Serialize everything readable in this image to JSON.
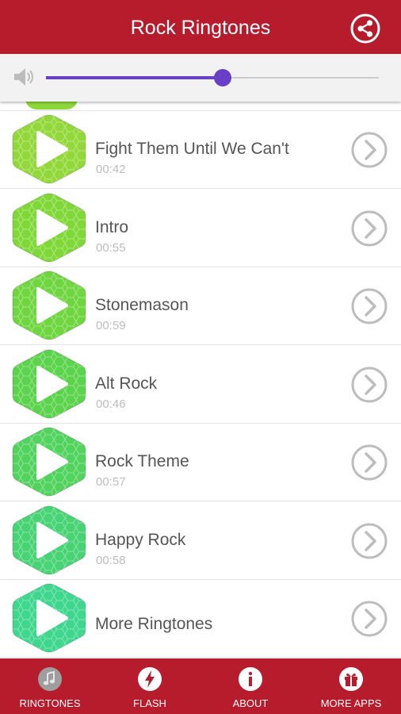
{
  "app_bar": {
    "title": "Rock Ringtones",
    "icon": "share-icon"
  },
  "volume": {
    "icon": "speaker-icon",
    "level_percent": 53
  },
  "colors": {
    "brand_red": "#b71c2c",
    "accent_purple": "#6a3fc8"
  },
  "ringtones": [
    {
      "title": "Fight Them Until We Can't",
      "duration": "00:42",
      "color": "#92d83a",
      "icon": "play-icon"
    },
    {
      "title": "Intro",
      "duration": "00:55",
      "color": "#80d838",
      "icon": "play-icon"
    },
    {
      "title": "Stonemason",
      "duration": "00:59",
      "color": "#6fd640",
      "icon": "play-icon"
    },
    {
      "title": "Alt Rock",
      "duration": "00:46",
      "color": "#5cd34c",
      "icon": "play-icon"
    },
    {
      "title": "Rock Theme",
      "duration": "00:57",
      "color": "#52d35e",
      "icon": "play-icon"
    },
    {
      "title": "Happy Rock",
      "duration": "00:58",
      "color": "#48d374",
      "icon": "play-icon"
    },
    {
      "title": "More Ringtones",
      "duration": "",
      "color": "#3fd68e",
      "icon": "play-icon"
    }
  ],
  "bottom_nav": [
    {
      "label": "RINGTONES",
      "icon": "music-note-icon"
    },
    {
      "label": "FLASH",
      "icon": "lightning-icon"
    },
    {
      "label": "ABOUT",
      "icon": "info-icon"
    },
    {
      "label": "MORE APPS",
      "icon": "gift-icon"
    }
  ]
}
